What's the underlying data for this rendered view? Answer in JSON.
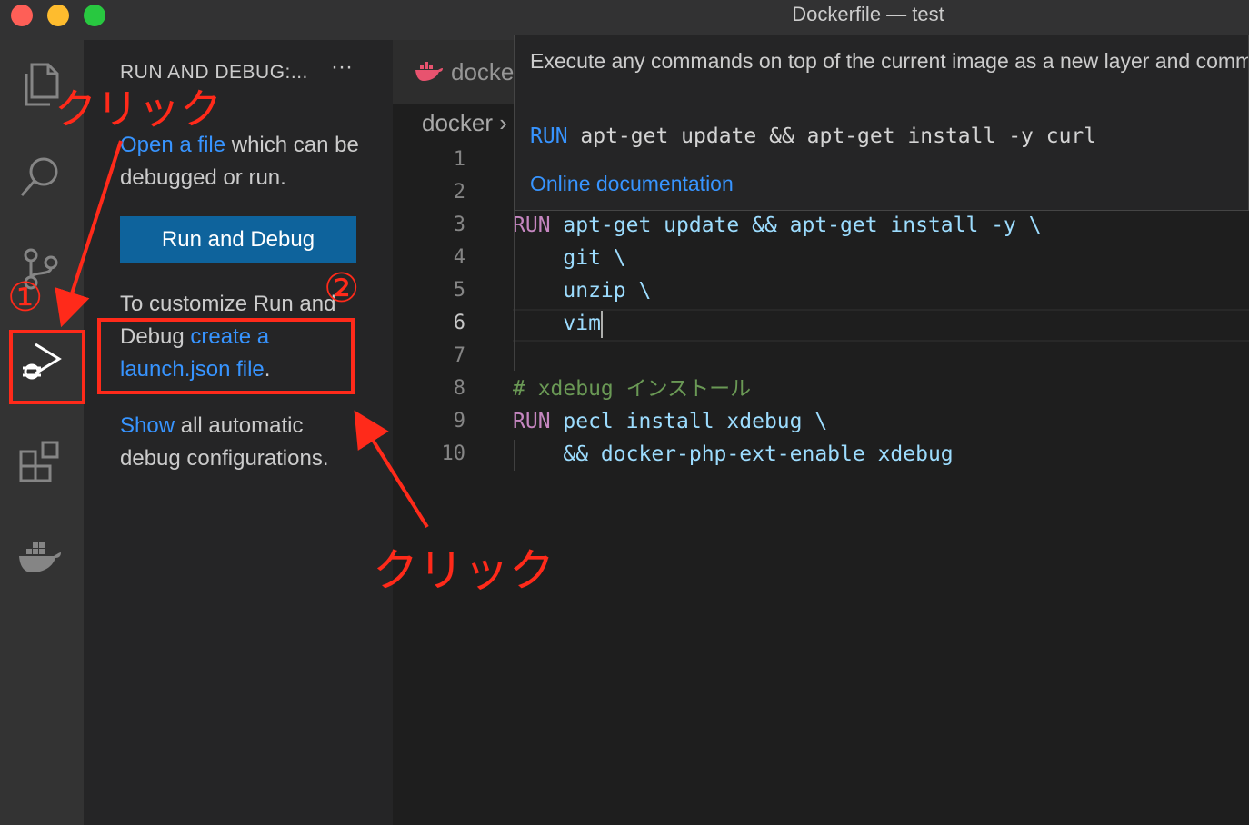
{
  "window": {
    "title": "Dockerfile — test"
  },
  "activity_bar": {
    "items": [
      {
        "name": "explorer-icon"
      },
      {
        "name": "search-icon"
      },
      {
        "name": "source-control-icon"
      },
      {
        "name": "run-debug-icon",
        "active": true
      },
      {
        "name": "extensions-icon"
      },
      {
        "name": "docker-icon"
      }
    ]
  },
  "sidebar": {
    "title": "RUN AND DEBUG:...",
    "more_label": "···",
    "open_file": {
      "link": "Open a file",
      "text": " which can be debugged or run."
    },
    "run_button": "Run and Debug",
    "customize": {
      "text": "To customize Run and Debug ",
      "link": "create a launch.json file",
      "suffix": "."
    },
    "show": {
      "link": "Show",
      "text": " all automatic debug configurations."
    }
  },
  "editor": {
    "tab_label": "docke",
    "breadcrumb": "docker ›",
    "line_numbers": [
      "1",
      "2",
      "3",
      "4",
      "5",
      "6",
      "7",
      "8",
      "9",
      "10"
    ],
    "active_line": 6,
    "lines": [
      {
        "kw": "",
        "text": ""
      },
      {
        "kw": "",
        "text": ""
      },
      {
        "kw": "RUN",
        "text": " apt-get update && apt-get install -y \\"
      },
      {
        "kw": "",
        "text": "    git \\"
      },
      {
        "kw": "",
        "text": "    unzip \\"
      },
      {
        "kw": "",
        "text": "    vim"
      },
      {
        "kw": "",
        "text": ""
      },
      {
        "comment": "# xdebug インストール"
      },
      {
        "kw": "RUN",
        "text": " pecl install xdebug \\"
      },
      {
        "kw": "",
        "text": "    && docker-php-ext-enable xdebug"
      }
    ]
  },
  "hover": {
    "description": "Execute any commands on top of the current image as a new layer and commit the results.",
    "example_kw": "RUN",
    "example_text": " apt-get update && apt-get install -y curl",
    "link": "Online documentation"
  },
  "annotations": {
    "click_label_1": "クリック",
    "click_label_2": "クリック",
    "marker_1": "①",
    "marker_2": "②"
  },
  "colors": {
    "accent": "#0e639c",
    "link": "#3794ff",
    "keyword": "#c586c0",
    "variable": "#9cdcfe",
    "comment": "#6a9955",
    "annotation": "#ff2a1a"
  }
}
